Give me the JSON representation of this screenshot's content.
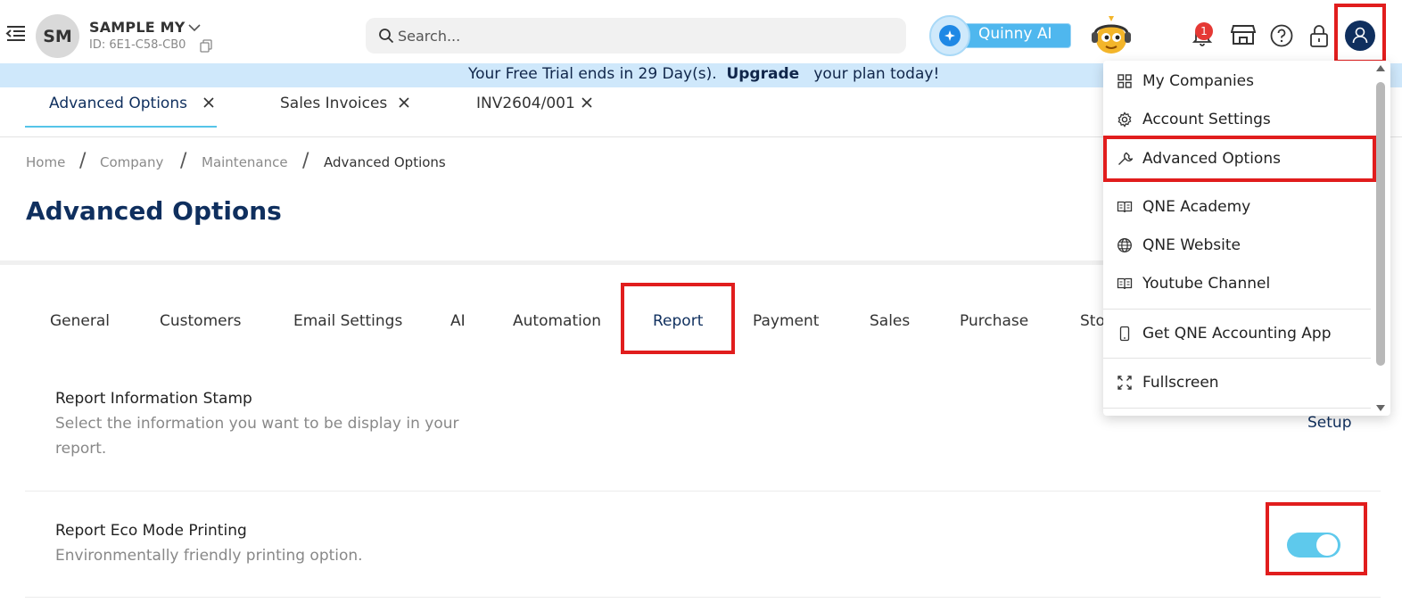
{
  "header": {
    "company_initials": "SM",
    "company_name": "SAMPLE MY",
    "company_id": "ID: 6E1-C58-CB0",
    "search_placeholder": "Search...",
    "ai_label": "Quinny AI",
    "notification_count": "1"
  },
  "banner": {
    "prefix": "Your Free Trial ends in 29 Day(s).",
    "upgrade": "Upgrade",
    "suffix": "your plan today!"
  },
  "tabs": [
    {
      "label": "Advanced Options",
      "active": true
    },
    {
      "label": "Sales Invoices",
      "active": false
    },
    {
      "label": "INV2604/001",
      "active": false
    }
  ],
  "breadcrumb": [
    "Home",
    "Company",
    "Maintenance",
    "Advanced Options"
  ],
  "page_title": "Advanced Options",
  "option_tabs": [
    "General",
    "Customers",
    "Email Settings",
    "AI",
    "Automation",
    "Report",
    "Payment",
    "Sales",
    "Purchase",
    "Sto"
  ],
  "selected_option_tab": "Report",
  "settings": [
    {
      "title": "Report Information Stamp",
      "description": "Select the information you want to be display in your report.",
      "action": "Setup"
    },
    {
      "title": "Report Eco Mode Printing",
      "description": "Environmentally friendly printing option.",
      "toggle_on": true
    }
  ],
  "user_menu": [
    {
      "label": "My Companies",
      "icon": "grid-icon"
    },
    {
      "label": "Account Settings",
      "icon": "gear-icon"
    },
    {
      "label": "Advanced Options",
      "icon": "wrench-icon"
    },
    {
      "label": "QNE Academy",
      "icon": "book-icon"
    },
    {
      "label": "QNE Website",
      "icon": "globe-icon"
    },
    {
      "label": "Youtube Channel",
      "icon": "book-icon"
    },
    {
      "label": "Get QNE Accounting App",
      "icon": "phone-icon"
    },
    {
      "label": "Fullscreen",
      "icon": "fullscreen-icon"
    }
  ],
  "colors": {
    "brand_navy": "#0f2f5e",
    "accent_cyan": "#5ec9ec",
    "highlight_red": "#e11d1d",
    "banner_bg": "#cfe8fb"
  }
}
